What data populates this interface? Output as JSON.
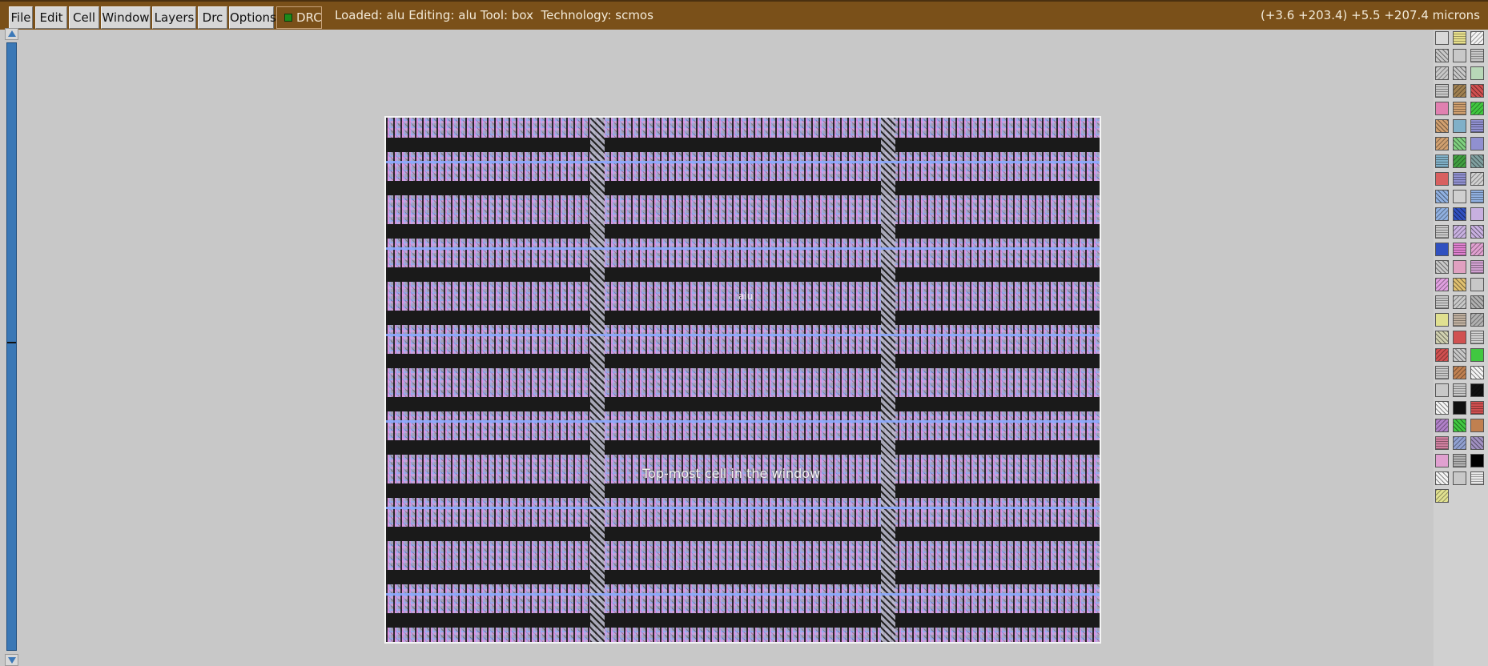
{
  "menu": [
    {
      "id": "file",
      "label": "File"
    },
    {
      "id": "edit",
      "label": "Edit"
    },
    {
      "id": "cell",
      "label": "Cell"
    },
    {
      "id": "window",
      "label": "Window"
    },
    {
      "id": "layers",
      "label": "Layers"
    },
    {
      "id": "drc-menu",
      "label": "Drc"
    },
    {
      "id": "options",
      "label": "Options"
    }
  ],
  "drc_toggle": {
    "label": "DRC",
    "indicator_color": "#1c8a1c"
  },
  "status": {
    "left": "Loaded: alu Editing: alu Tool: box  Technology: scmos",
    "right": "(+3.6 +203.4) +5.5 +207.4 microns"
  },
  "layout": {
    "cell_name": "alu",
    "window_label": "Top-most cell in the window"
  },
  "colors": {
    "title_bar": "#7a5019",
    "canvas_background": "#c8c8c8",
    "scrollbar": "#3a78b6"
  },
  "palette": {
    "swatches": [
      "#d8d8d8",
      "#e8e08c",
      "#f4f4f4",
      "#c8c8c8",
      "#c8c8c8",
      "#c8c8c8",
      "#c8c8c8",
      "#c8c8c8",
      "#b8d8b8",
      "#c8c8c8",
      "#a08050",
      "#d05050",
      "#e080b0",
      "#d0a070",
      "#40c840",
      "#d0a070",
      "#80b0c8",
      "#9090d0",
      "#d0a070",
      "#80d080",
      "#9090d0",
      "#80b0c8",
      "#40a040",
      "#80a0a0",
      "#d86060",
      "#9090d0",
      "#d0d0d0",
      "#90b0e0",
      "#d0d0d0",
      "#90b0e0",
      "#90b0e0",
      "#3050c0",
      "#c8b0e0",
      "#c8c8c8",
      "#c8b0e0",
      "#c8b0e0",
      "#3050c0",
      "#e080d0",
      "#e0a0d0",
      "#c8c8c8",
      "#e0a0c0",
      "#d0a0d0",
      "#e0a0e0",
      "#e0c070",
      "#c8c8c8",
      "#c8c8c8",
      "#c8c8c8",
      "#b0b0b0",
      "#e0e090",
      "#c0b0a0",
      "#b0b0b0",
      "#d0d0b0",
      "#d05050",
      "#d0d0d0",
      "#d05050",
      "#c8c8c8",
      "#40c840",
      "#c8c8c8",
      "#c08050",
      "#f4f4f4",
      "#c8c8c8",
      "#c8c8c8",
      "#101010",
      "#f4f4f4",
      "#101010",
      "#d05050",
      "#b080c8",
      "#40c840",
      "#c08050",
      "#d080a0",
      "#90a0d0",
      "#a090c0",
      "#e0a0d0",
      "#b0b0b0",
      "#000000",
      "#f4f4f4",
      "#c8c8c8",
      "#e8e8e8",
      "#e0e090"
    ]
  }
}
